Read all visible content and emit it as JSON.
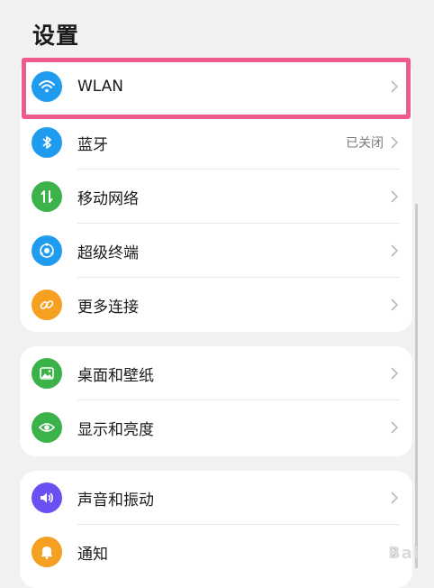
{
  "header": {
    "title": "设置"
  },
  "groups": [
    {
      "items": [
        {
          "label": "WLAN",
          "icon": "wifi-icon",
          "color": "#1f9bf0",
          "status": ""
        },
        {
          "label": "蓝牙",
          "icon": "bluetooth-icon",
          "color": "#1f9bf0",
          "status": "已关闭"
        },
        {
          "label": "移动网络",
          "icon": "mobile-network-icon",
          "color": "#3bb24a",
          "status": ""
        },
        {
          "label": "超级终端",
          "icon": "super-device-icon",
          "color": "#1f9bf0",
          "status": ""
        },
        {
          "label": "更多连接",
          "icon": "link-icon",
          "color": "#f5a020",
          "status": ""
        }
      ]
    },
    {
      "items": [
        {
          "label": "桌面和壁纸",
          "icon": "wallpaper-icon",
          "color": "#3bb24a",
          "status": ""
        },
        {
          "label": "显示和亮度",
          "icon": "eye-icon",
          "color": "#3bb24a",
          "status": ""
        }
      ]
    },
    {
      "items": [
        {
          "label": "声音和振动",
          "icon": "speaker-icon",
          "color": "#6a4ff2",
          "status": ""
        },
        {
          "label": "通知",
          "icon": "bell-icon",
          "color": "#f5a020",
          "status": ""
        }
      ]
    }
  ],
  "watermark": "Bai"
}
